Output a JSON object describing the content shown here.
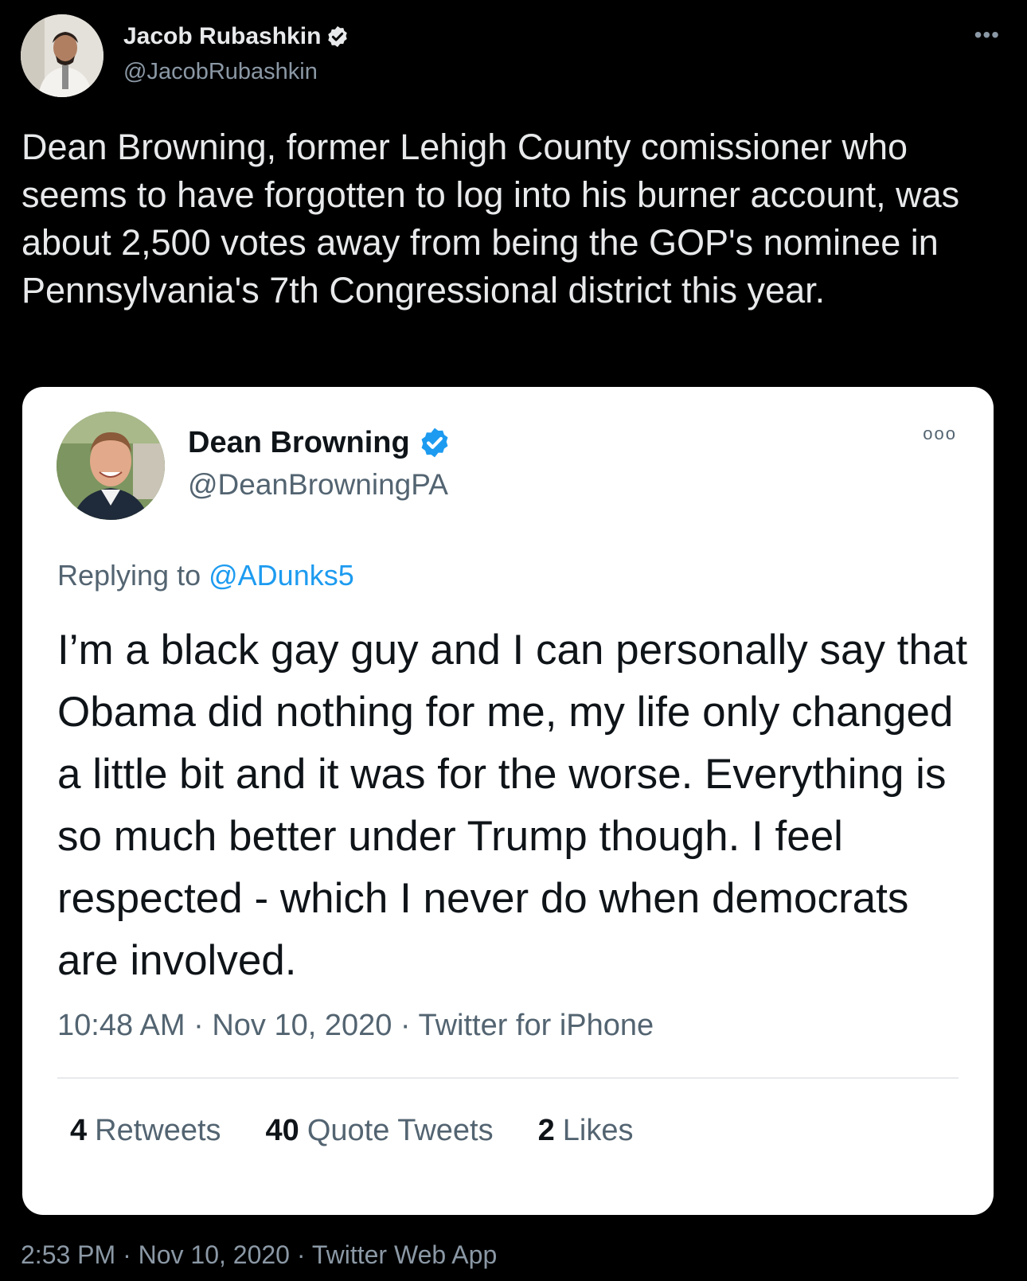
{
  "author": {
    "display_name": "Jacob Rubashkin",
    "handle": "@JacobRubashkin",
    "verified_icon": "verified-badge-icon"
  },
  "more_icon": "more-options-icon",
  "tweet_text": "Dean Browning, former Lehigh County comissioner who seems to have forgotten to log into his burner account, was about 2,500 votes away from being the GOP's nominee in Pennsylvania's 7th Congressional district this year.",
  "quoted": {
    "display_name": "Dean Browning",
    "handle": "@DeanBrowningPA",
    "replying_prefix": "Replying to",
    "replying_mention": "@ADunks5",
    "text": "I’m a black gay guy and I can personally say that Obama did nothing for me, my life only changed a little bit and it was for the worse. Everything is so much better under Trump though. I feel respected - which I never do when democrats are involved.",
    "meta": "10:48 AM · Nov 10, 2020 · Twitter for iPhone",
    "stats": {
      "retweets_count": "4",
      "retweets_label": "Retweets",
      "quotes_count": "40",
      "quotes_label": "Quote Tweets",
      "likes_count": "2",
      "likes_label": "Likes"
    }
  },
  "footer_meta": "2:53 PM · Nov 10, 2020 · Twitter Web App",
  "colors": {
    "background": "#000000",
    "card_background": "#ffffff",
    "accent": "#1d9bf0",
    "muted": "#8b98a5"
  }
}
